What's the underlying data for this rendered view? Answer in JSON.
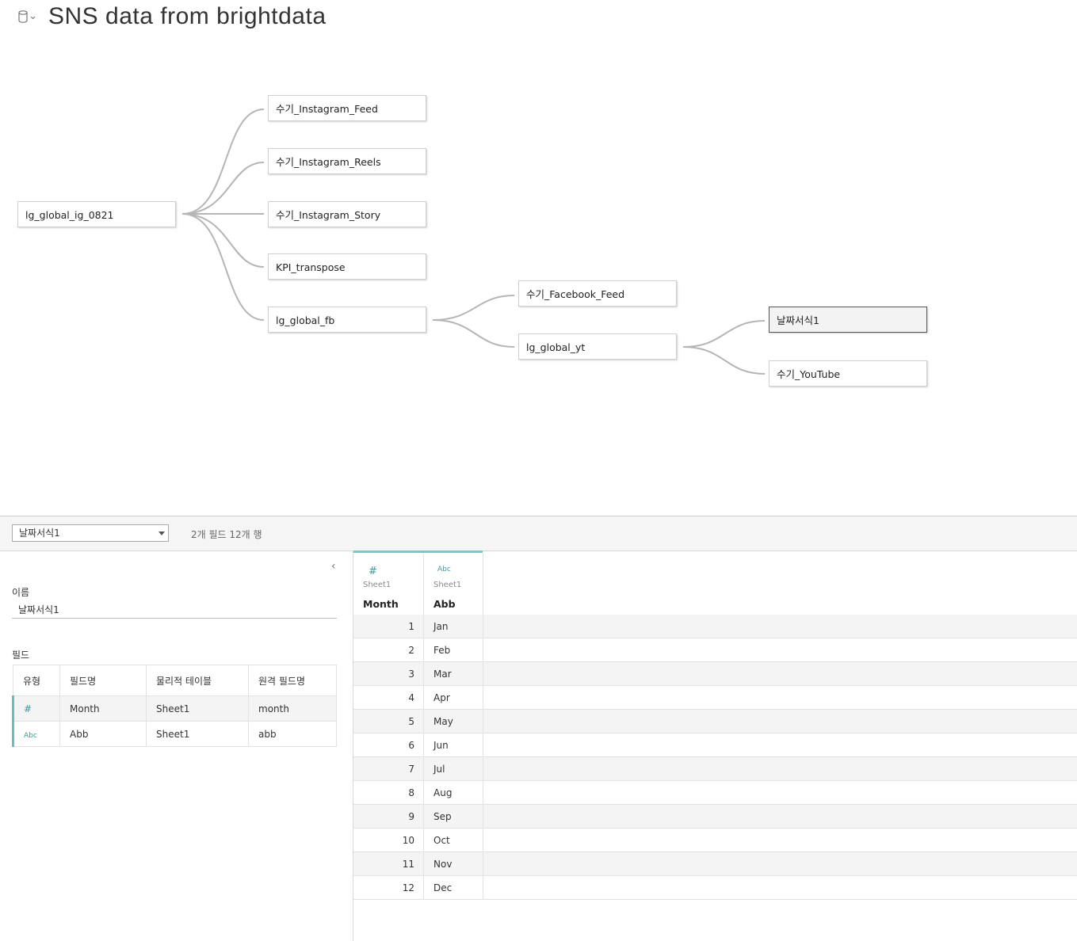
{
  "header": {
    "title": "SNS data from brightdata",
    "icon": "database-icon"
  },
  "flow": {
    "nodes": [
      {
        "id": "n0",
        "label": "lg_global_ig_0821"
      },
      {
        "id": "n1",
        "label": "수기_Instagram_Feed"
      },
      {
        "id": "n2",
        "label": "수기_Instagram_Reels"
      },
      {
        "id": "n3",
        "label": "수기_Instagram_Story"
      },
      {
        "id": "n4",
        "label": "KPI_transpose"
      },
      {
        "id": "n5",
        "label": "lg_global_fb"
      },
      {
        "id": "n6",
        "label": "수기_Facebook_Feed"
      },
      {
        "id": "n7",
        "label": "lg_global_yt"
      },
      {
        "id": "n8",
        "label": "날짜서식1",
        "selected": true
      },
      {
        "id": "n9",
        "label": "수기_YouTube"
      }
    ]
  },
  "bottom": {
    "selected_table": "날짜서식1",
    "summary": "2개 필드 12개 행"
  },
  "details": {
    "name_label": "이름",
    "name_value": "날짜서식1",
    "fields_label": "필드",
    "columns": [
      "유형",
      "필드명",
      "물리적 테이블",
      "원격 필드명"
    ],
    "rows": [
      {
        "type": "#",
        "field": "Month",
        "table": "Sheet1",
        "remote": "month"
      },
      {
        "type": "Abc",
        "field": "Abb",
        "table": "Sheet1",
        "remote": "abb"
      }
    ]
  },
  "grid": {
    "columns": [
      {
        "icon": "#",
        "source": "Sheet1",
        "name": "Month"
      },
      {
        "icon": "Abc",
        "source": "Sheet1",
        "name": "Abb"
      }
    ],
    "rows": [
      {
        "month": "1",
        "abb": "Jan"
      },
      {
        "month": "2",
        "abb": "Feb"
      },
      {
        "month": "3",
        "abb": "Mar"
      },
      {
        "month": "4",
        "abb": "Apr"
      },
      {
        "month": "5",
        "abb": "May"
      },
      {
        "month": "6",
        "abb": "Jun"
      },
      {
        "month": "7",
        "abb": "Jul"
      },
      {
        "month": "8",
        "abb": "Aug"
      },
      {
        "month": "9",
        "abb": "Sep"
      },
      {
        "month": "10",
        "abb": "Oct"
      },
      {
        "month": "11",
        "abb": "Nov"
      },
      {
        "month": "12",
        "abb": "Dec"
      }
    ]
  }
}
